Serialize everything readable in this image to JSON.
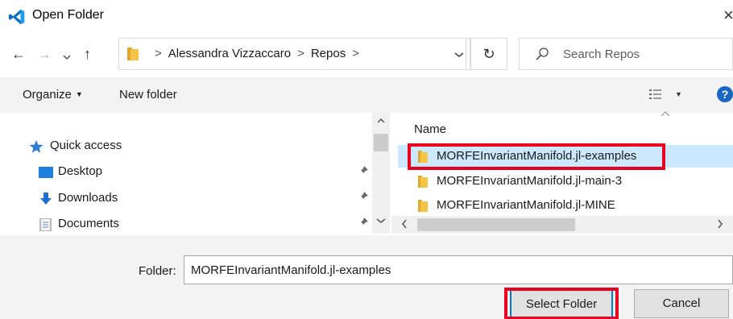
{
  "window": {
    "title": "Open Folder",
    "close_glyph": "×",
    "app_icon": "vscode-icon"
  },
  "navbar": {
    "back_glyph": "←",
    "forward_glyph": "→",
    "recent_glyph": "⌄",
    "up_glyph": "↑",
    "breadcrumbs": [
      "Alessandra Vizzaccaro",
      "Repos"
    ],
    "crumb_separator": ">",
    "dropdown_glyph": "⌄",
    "refresh_glyph": "↻",
    "search_placeholder": "Search Repos"
  },
  "toolbar": {
    "organize_label": "Organize",
    "organize_caret": "▼",
    "new_folder_label": "New folder",
    "view_caret": "▼",
    "help_glyph": "?"
  },
  "nav_pane": {
    "items": [
      {
        "label": "Quick access",
        "icon": "star-icon",
        "pinned": false
      },
      {
        "label": "Desktop",
        "icon": "desktop-icon",
        "pinned": true
      },
      {
        "label": "Downloads",
        "icon": "download-icon",
        "pinned": true
      },
      {
        "label": "Documents",
        "icon": "document-icon",
        "pinned": true
      }
    ],
    "pin_glyph": "📌"
  },
  "file_pane": {
    "column_name": "Name",
    "files": [
      {
        "label": "MORFEInvariantManifold.jl-examples",
        "selected": true
      },
      {
        "label": "MORFEInvariantManifold.jl-main-3",
        "selected": false
      },
      {
        "label": "MORFEInvariantManifold.jl-MINE",
        "selected": false
      }
    ]
  },
  "footer": {
    "folder_label": "Folder:",
    "folder_value": "MORFEInvariantManifold.jl-examples",
    "select_button": "Select Folder",
    "cancel_button": "Cancel"
  },
  "colors": {
    "highlight_red": "#e8001e",
    "selection_blue": "#cce8ff",
    "folder_yellow": "#f5c445",
    "accent_blue": "#0078d7"
  }
}
